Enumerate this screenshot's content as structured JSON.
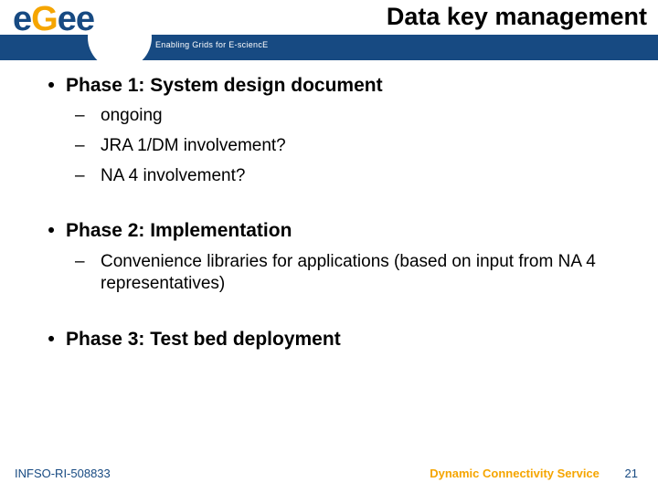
{
  "header": {
    "title": "Data key management",
    "logo_e1": "e",
    "logo_g": "G",
    "logo_e2": "e",
    "logo_e3": "e",
    "tagline": "Enabling Grids for E-sciencE"
  },
  "content": {
    "phase1": {
      "heading": "Phase 1: System design document",
      "items": [
        "ongoing",
        "JRA 1/DM involvement?",
        "NA 4 involvement?"
      ]
    },
    "phase2": {
      "heading": "Phase 2: Implementation",
      "items": [
        "Convenience libraries for applications (based on input from NA 4 representatives)"
      ]
    },
    "phase3": {
      "heading": "Phase 3: Test bed deployment"
    }
  },
  "footer": {
    "left": "INFSO-RI-508833",
    "right": "Dynamic Connectivity Service",
    "page": "21"
  }
}
